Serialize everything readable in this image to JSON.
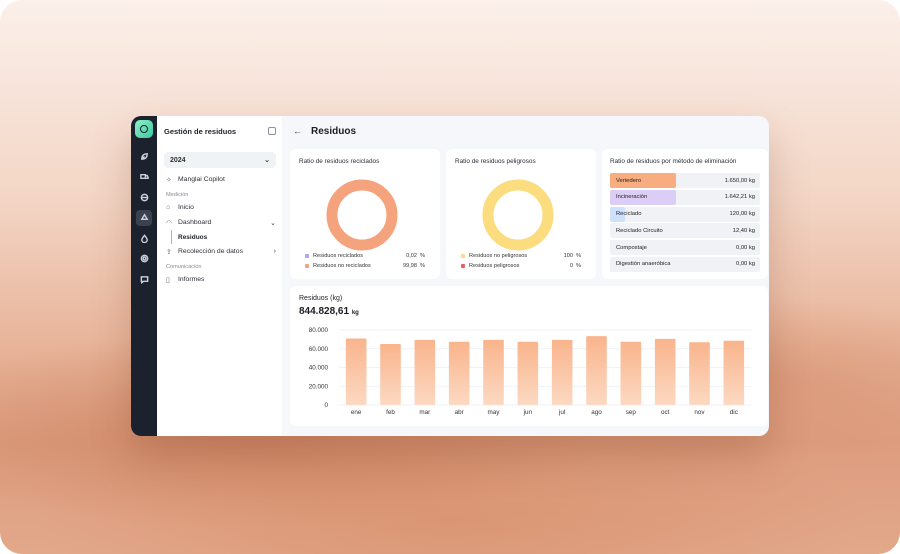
{
  "sidebar": {
    "title": "Gestión de residuos",
    "year": "2024",
    "copilot": "Manglai Copilot",
    "section_medicion": "Medición",
    "inicio": "Inicio",
    "dashboard": "Dashboard",
    "residuos": "Residuos",
    "recoleccion": "Recolección de datos",
    "section_comunicacion": "Comunicación",
    "informes": "Informes"
  },
  "header": {
    "title": "Residuos"
  },
  "recycled": {
    "title": "Ratio de residuos reciclados",
    "items": [
      {
        "label": "Residuos reciclados",
        "value": "0,02",
        "unit": "%",
        "color": "#a9a6ee"
      },
      {
        "label": "Residuos no reciclados",
        "value": "99,98",
        "unit": "%",
        "color": "#f5a37c"
      }
    ],
    "fraction_recycled": 0.0002
  },
  "hazardous": {
    "title": "Ratio de residuos peligrosos",
    "items": [
      {
        "label": "Residuos no peligrosos",
        "value": "100",
        "unit": "%",
        "color": "#fbdc7e"
      },
      {
        "label": "Residuos peligrosos",
        "value": "0",
        "unit": "%",
        "color": "#f05a6b"
      }
    ],
    "fraction_hazardous": 0
  },
  "methods": {
    "title": "Ratio de residuos por método de eliminación",
    "rows": [
      {
        "label": "Vertedero",
        "value": "1.650,00 kg",
        "share": 0.44,
        "color": "#f7ad80"
      },
      {
        "label": "Incineración",
        "value": "1.642,21 kg",
        "share": 0.44,
        "color": "#dccdf6"
      },
      {
        "label": "Reciclado",
        "value": "120,00 kg",
        "share": 0.1,
        "color": "#cfe0fb"
      },
      {
        "label": "Reciclado Circuito",
        "value": "12,40 kg",
        "share": 0.0,
        "color": "#f0f2f5"
      },
      {
        "label": "Compostaje",
        "value": "0,00 kg",
        "share": 0.0,
        "color": "#f0f2f5"
      },
      {
        "label": "Digestión anaeróbica",
        "value": "0,00 kg",
        "share": 0.0,
        "color": "#f0f2f5"
      }
    ]
  },
  "residuos_chart": {
    "title": "Residuos (kg)",
    "total": "844.828,61",
    "total_unit": "kg"
  },
  "chart_data": {
    "type": "bar",
    "title": "Residuos (kg)",
    "categories": [
      "ene",
      "feb",
      "mar",
      "abr",
      "may",
      "jun",
      "jul",
      "ago",
      "sep",
      "oct",
      "nov",
      "dic"
    ],
    "values": [
      71000,
      65000,
      69500,
      67500,
      69500,
      67500,
      69500,
      73500,
      67500,
      70500,
      67000,
      68500
    ],
    "ylim": [
      0,
      80000
    ],
    "yticks": [
      "80.000",
      "60.000",
      "40.000",
      "20.000",
      "0"
    ],
    "ytick_values": [
      80000,
      60000,
      40000,
      20000,
      0
    ],
    "grid": true,
    "bar_color_top": "#f9b48c",
    "bar_color_bottom": "#fcd9c2"
  }
}
